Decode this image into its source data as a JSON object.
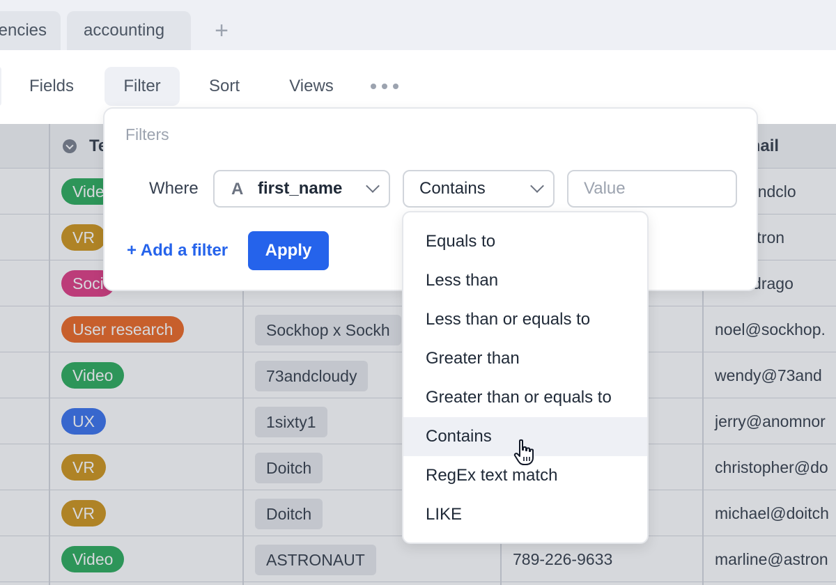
{
  "tabs": [
    {
      "label": "encies"
    },
    {
      "label": "accounting"
    }
  ],
  "tab_add_label": "+",
  "toolbar": {
    "fields": "Fields",
    "filter": "Filter",
    "sort": "Sort",
    "views": "Views"
  },
  "table": {
    "headers": {
      "tag": "Te",
      "email": "mail"
    },
    "rows": [
      {
        "tag": "Vide",
        "tag_color": "#16a34a",
        "company": "",
        "phone": "",
        "email": "@73andclo"
      },
      {
        "tag": "VR",
        "tag_color": "#ca8a04",
        "company": "",
        "phone": "",
        "email": "h@astron"
      },
      {
        "tag": "Soci",
        "tag_color": "#db2777",
        "company": "",
        "phone": "",
        "email": "ael@drago"
      },
      {
        "tag": "User research",
        "tag_color": "#ea580c",
        "company": "Sockhop x Sockh",
        "phone": "",
        "email": "noel@sockhop."
      },
      {
        "tag": "Video",
        "tag_color": "#16a34a",
        "company": "73andcloudy",
        "phone": "",
        "email": "wendy@73and"
      },
      {
        "tag": "UX",
        "tag_color": "#2563eb",
        "company": "1sixty1",
        "phone": "",
        "email": "jerry@anomnor"
      },
      {
        "tag": "VR",
        "tag_color": "#ca8a04",
        "company": "Doitch",
        "phone": "",
        "email": "christopher@do"
      },
      {
        "tag": "VR",
        "tag_color": "#ca8a04",
        "company": "Doitch",
        "phone": "",
        "email": "michael@doitch"
      },
      {
        "tag": "Video",
        "tag_color": "#16a34a",
        "company": "ASTRONAUT",
        "phone": "789-226-9633",
        "email": "marline@astron"
      }
    ]
  },
  "filter_popover": {
    "title": "Filters",
    "where_label": "Where",
    "field_glyph": "A",
    "field_value": "first_name",
    "operator_value": "Contains",
    "value_placeholder": "Value",
    "add_filter_label": "+ Add a filter",
    "apply_label": "Apply"
  },
  "operator_menu": {
    "items": [
      "Equals to",
      "Less than",
      "Less than or equals to",
      "Greater than",
      "Greater than or equals to",
      "Contains",
      "RegEx text match",
      "LIKE"
    ],
    "hovered": "Contains"
  },
  "colors": {
    "accent": "#2563eb",
    "green": "#16a34a",
    "yellow": "#ca8a04",
    "pink": "#db2777",
    "orange": "#ea580c",
    "blue": "#2563eb"
  }
}
